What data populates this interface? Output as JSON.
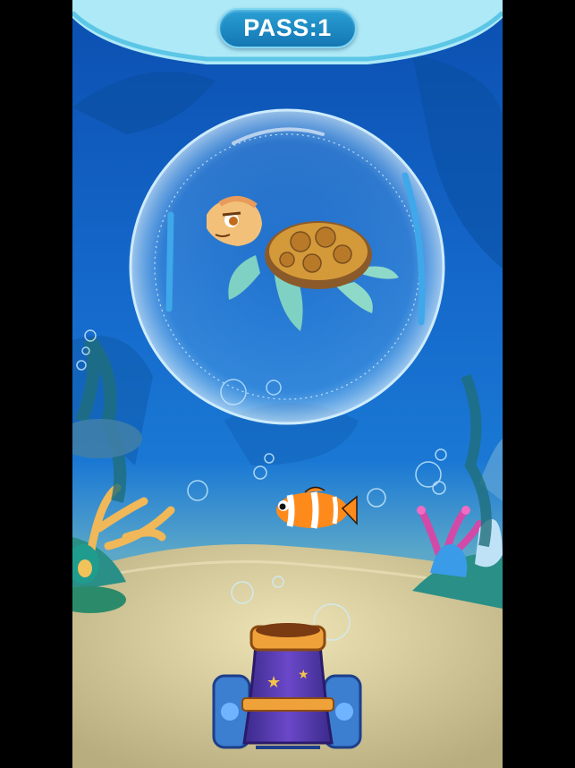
{
  "hud": {
    "pass_label": "PASS:1"
  },
  "scene": {
    "characters": [
      "sea-turtle",
      "clownfish"
    ],
    "player": "cannon",
    "target_container": "bubble"
  },
  "colors": {
    "water_top": "#0b4fb0",
    "water_mid": "#1a6fd0",
    "sand": "#c8c39a",
    "banner": "#aee9f7",
    "badge": "#1e8cc8"
  }
}
